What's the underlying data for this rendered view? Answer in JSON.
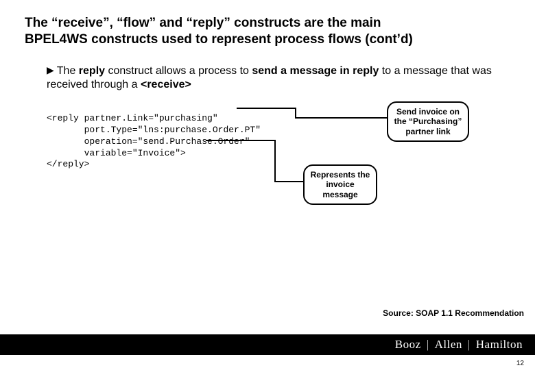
{
  "title_line1": "The “receive”, “flow” and “reply” constructs are the main",
  "title_line2": "BPEL4WS constructs used to represent process flows (cont’d)",
  "bullet": {
    "pre": "The ",
    "b1": "reply",
    "mid1": " construct allows a process to ",
    "b2": "send a message in reply",
    "mid2": " to a message that was received through a ",
    "b3": "<receive>"
  },
  "code": {
    "l1": "<reply partner.Link=\"purchasing\"",
    "l2": "       port.Type=\"lns:purchase.Order.PT\"",
    "l3": "       operation=\"send.Purchase.Order\"",
    "l4": "       variable=\"Invoice\">",
    "l5": "</reply>"
  },
  "callout1": "Send invoice on the “Purchasing” partner link",
  "callout2": "Represents the invoice message",
  "source": "Source: SOAP 1.1 Recommendation",
  "footer": {
    "p1": "Booz",
    "p2": "Allen",
    "p3": "Hamilton"
  },
  "page": "12"
}
